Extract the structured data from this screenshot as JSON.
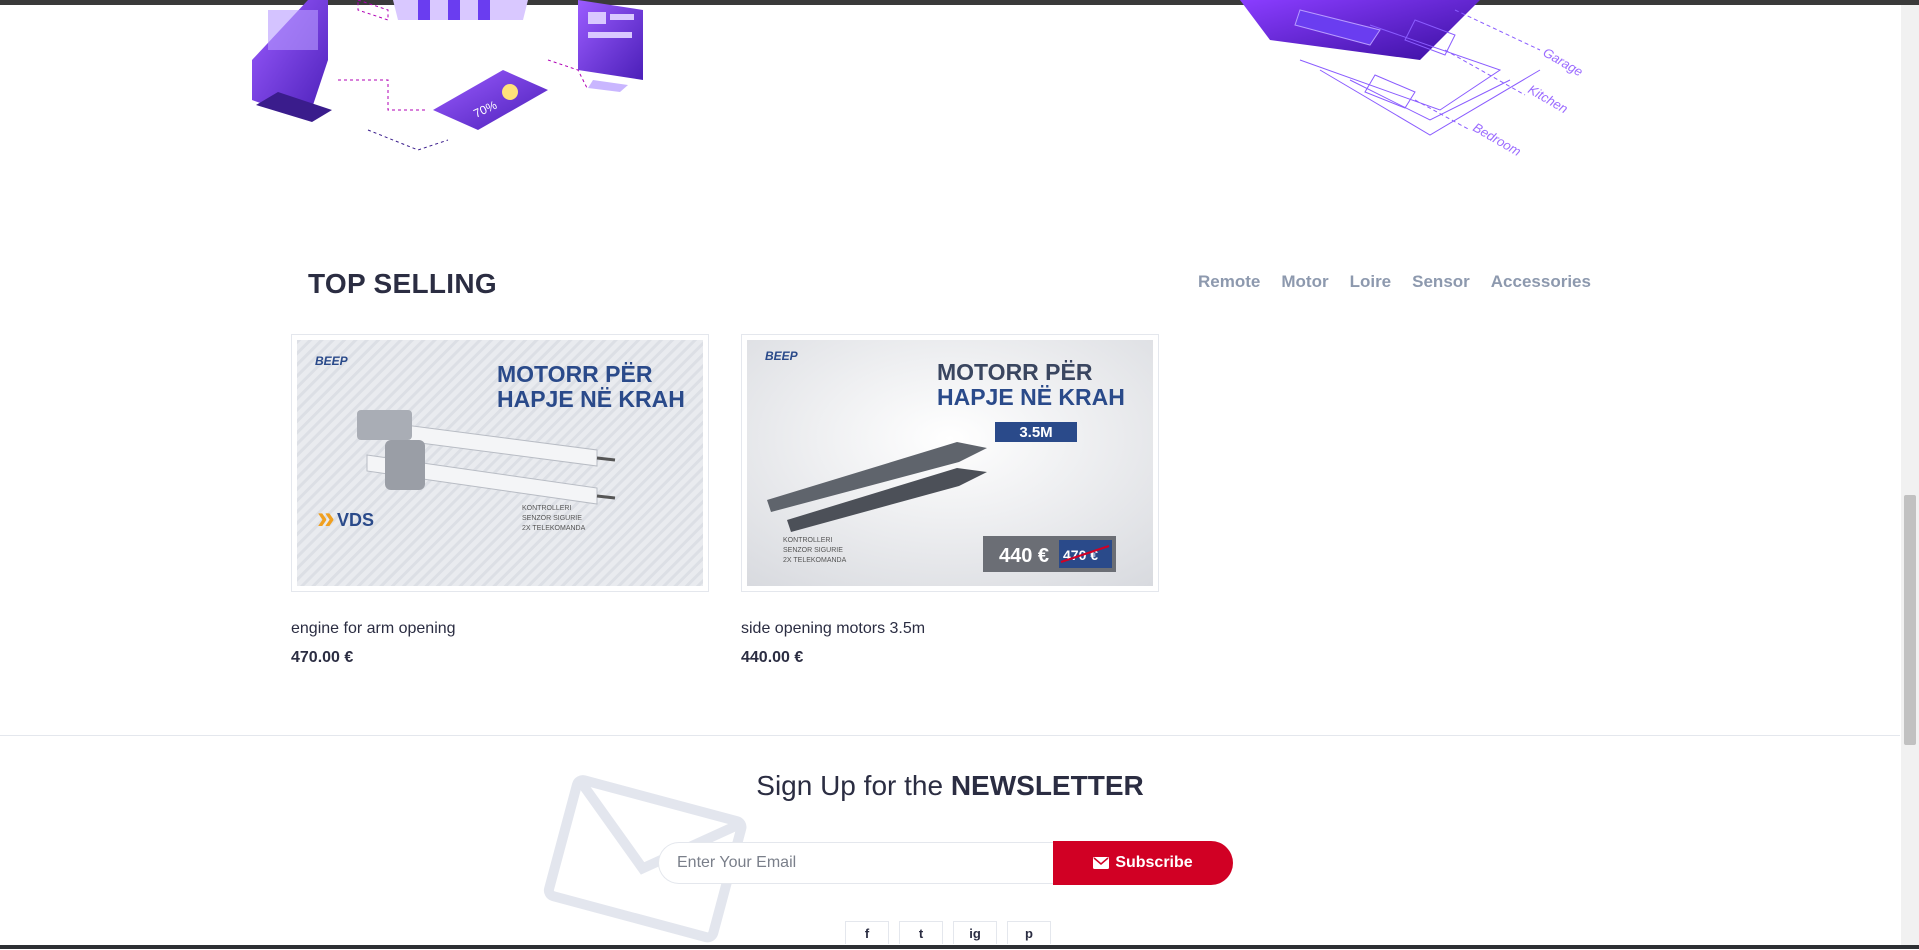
{
  "top_selling": {
    "title": "TOP SELLING",
    "categories": [
      "Remote",
      "Motor",
      "Loire",
      "Sensor",
      "Accessories"
    ]
  },
  "hero": {
    "left_phone_label": "70%",
    "room_labels": [
      "Garage",
      "Kitchen",
      "Bedroom"
    ]
  },
  "products": [
    {
      "name": "engine for arm opening",
      "price": "470.00 €",
      "image": {
        "brand": "BEEP",
        "headline_1": "MOTORR PËR",
        "headline_2": "HAPJE NË KRAH",
        "footer_brand": "VDS",
        "specs": [
          "KONTROLLERI",
          "SENZOR SIGURIE",
          "2X TELEKOMANDA"
        ]
      }
    },
    {
      "name": "side opening motors 3.5m",
      "price": "440.00 €",
      "image": {
        "brand": "BEEP",
        "headline_1": "MOTORR PËR",
        "headline_2": "HAPJE NË KRAH",
        "badge": "3.5M",
        "specs": [
          "KONTROLLERI",
          "SENZOR SIGURIE",
          "2X TELEKOMANDA"
        ],
        "new_price": "440 €",
        "old_price": "470 €"
      }
    }
  ],
  "newsletter": {
    "title_prefix": "Sign Up for the",
    "title_strong": "NEWSLETTER",
    "placeholder": "Enter Your Email",
    "button_label": "Subscribe"
  },
  "socials": {
    "facebook": "f",
    "twitter": "t",
    "instagram": "ig",
    "pinterest": "p"
  },
  "colors": {
    "accent": "#d10024",
    "heading": "#2b2d42",
    "muted": "#8d99ae",
    "illustration": "#7b2ff7"
  }
}
